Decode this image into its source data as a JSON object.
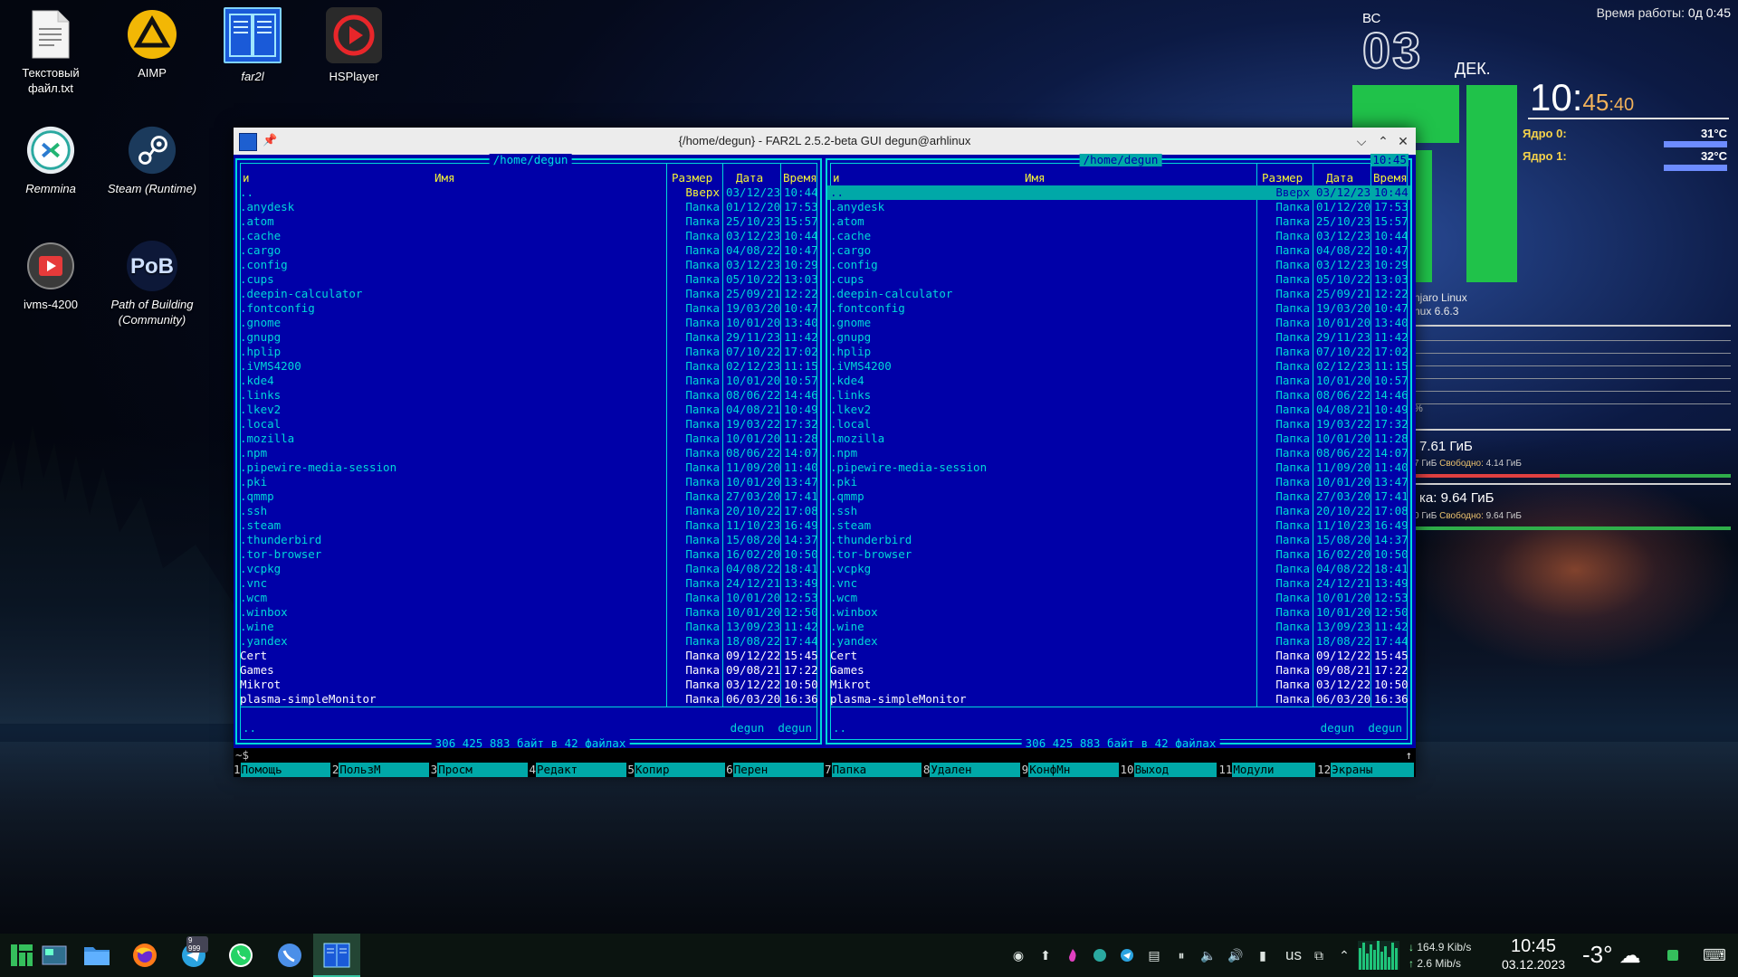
{
  "desktop": {
    "icons": [
      {
        "label": "Текстовый файл.txt",
        "icon": "text-file-icon",
        "italic": false
      },
      {
        "label": "AIMP",
        "icon": "aimp-icon",
        "italic": false
      },
      {
        "label": "far2l",
        "icon": "far2l-icon",
        "italic": true
      },
      {
        "label": "HSPlayer",
        "icon": "hsplayer-icon",
        "italic": false
      },
      {
        "label": "Remmina",
        "icon": "remmina-icon",
        "italic": true
      },
      {
        "label": "Steam (Runtime)",
        "icon": "steam-icon",
        "italic": true
      },
      {
        "label": "ivms-4200",
        "icon": "ivms-icon",
        "italic": false
      },
      {
        "label": "Path of Building (Community)",
        "icon": "pob-icon",
        "italic": true
      },
      {
        "label": "PoB",
        "icon": "pob-text",
        "italic": false
      }
    ]
  },
  "widgets": {
    "uptime_label": "Время работы:",
    "uptime_value": "0д 0:45",
    "date_dow": "ВС",
    "date_day": "03",
    "date_month": "ДЕК.",
    "clock_hm": "10:",
    "clock_m": "45",
    "clock_s": ":40",
    "cores": [
      {
        "label": "Ядро 0:",
        "temp": "31°C"
      },
      {
        "label": "Ядро 1:",
        "temp": "32°C"
      }
    ],
    "sysinfo_line1": "njaro Linux",
    "sysinfo_line2": "nux 6.6.3",
    "percent_fragment": "%",
    "mem1_big": "7.61 ГиБ",
    "mem1_small_prefix": "7 ГиБ",
    "mem1_free_label": "Свободно:",
    "mem1_free_value": "4.14 ГиБ",
    "mem2_big": "ка: 9.64 ГиБ",
    "mem2_small_prefix": "0 ГиБ",
    "mem2_free_label": "Свободно:",
    "mem2_free_value": "9.64 ГиБ"
  },
  "far": {
    "window_title": "{/home/degun} - FAR2L 2.5.2-beta GUI degun@arhlinux",
    "left_path": " /home/degun ",
    "right_path": " /home/degun ",
    "clock": "10:45",
    "col_n": "и",
    "col_name": "Имя",
    "col_size": "Размер",
    "col_date": "Дата",
    "col_time": "Время",
    "up_label": "Вверх",
    "up_name": "..",
    "up_date": "03/12/23",
    "up_time": "10:44",
    "rows": [
      {
        "name": ".anydesk",
        "size": "Папка",
        "date": "01/12/20",
        "time": "17:53",
        "bright": false
      },
      {
        "name": ".atom",
        "size": "Папка",
        "date": "25/10/23",
        "time": "15:57",
        "bright": false
      },
      {
        "name": ".cache",
        "size": "Папка",
        "date": "03/12/23",
        "time": "10:44",
        "bright": false
      },
      {
        "name": ".cargo",
        "size": "Папка",
        "date": "04/08/22",
        "time": "10:47",
        "bright": false
      },
      {
        "name": ".config",
        "size": "Папка",
        "date": "03/12/23",
        "time": "10:29",
        "bright": false
      },
      {
        "name": ".cups",
        "size": "Папка",
        "date": "05/10/22",
        "time": "13:03",
        "bright": false
      },
      {
        "name": ".deepin-calculator",
        "size": "Папка",
        "date": "25/09/21",
        "time": "12:22",
        "bright": false
      },
      {
        "name": ".fontconfig",
        "size": "Папка",
        "date": "19/03/20",
        "time": "10:47",
        "bright": false
      },
      {
        "name": ".gnome",
        "size": "Папка",
        "date": "10/01/20",
        "time": "13:40",
        "bright": false
      },
      {
        "name": ".gnupg",
        "size": "Папка",
        "date": "29/11/23",
        "time": "11:42",
        "bright": false
      },
      {
        "name": ".hplip",
        "size": "Папка",
        "date": "07/10/22",
        "time": "17:02",
        "bright": false
      },
      {
        "name": ".iVMS4200",
        "size": "Папка",
        "date": "02/12/23",
        "time": "11:15",
        "bright": false
      },
      {
        "name": ".kde4",
        "size": "Папка",
        "date": "10/01/20",
        "time": "10:57",
        "bright": false
      },
      {
        "name": ".links",
        "size": "Папка",
        "date": "08/06/22",
        "time": "14:46",
        "bright": false
      },
      {
        "name": ".lkev2",
        "size": "Папка",
        "date": "04/08/21",
        "time": "10:49",
        "bright": false
      },
      {
        "name": ".local",
        "size": "Папка",
        "date": "19/03/22",
        "time": "17:32",
        "bright": false
      },
      {
        "name": ".mozilla",
        "size": "Папка",
        "date": "10/01/20",
        "time": "11:28",
        "bright": false
      },
      {
        "name": ".npm",
        "size": "Папка",
        "date": "08/06/22",
        "time": "14:07",
        "bright": false
      },
      {
        "name": ".pipewire-media-session",
        "size": "Папка",
        "date": "11/09/20",
        "time": "11:40",
        "bright": false
      },
      {
        "name": ".pki",
        "size": "Папка",
        "date": "10/01/20",
        "time": "13:47",
        "bright": false
      },
      {
        "name": ".qmmp",
        "size": "Папка",
        "date": "27/03/20",
        "time": "17:41",
        "bright": false
      },
      {
        "name": ".ssh",
        "size": "Папка",
        "date": "20/10/22",
        "time": "17:08",
        "bright": false
      },
      {
        "name": ".steam",
        "size": "Папка",
        "date": "11/10/23",
        "time": "16:49",
        "bright": false
      },
      {
        "name": ".thunderbird",
        "size": "Папка",
        "date": "15/08/20",
        "time": "14:37",
        "bright": false
      },
      {
        "name": ".tor-browser",
        "size": "Папка",
        "date": "16/02/20",
        "time": "10:50",
        "bright": false
      },
      {
        "name": ".vcpkg",
        "size": "Папка",
        "date": "04/08/22",
        "time": "18:41",
        "bright": false
      },
      {
        "name": ".vnc",
        "size": "Папка",
        "date": "24/12/21",
        "time": "13:49",
        "bright": false
      },
      {
        "name": ".wcm",
        "size": "Папка",
        "date": "10/01/20",
        "time": "12:53",
        "bright": false
      },
      {
        "name": ".winbox",
        "size": "Папка",
        "date": "10/01/20",
        "time": "12:50",
        "bright": false
      },
      {
        "name": ".wine",
        "size": "Папка",
        "date": "13/09/23",
        "time": "11:42",
        "bright": false
      },
      {
        "name": ".yandex",
        "size": "Папка",
        "date": "18/08/22",
        "time": "17:44",
        "bright": false
      },
      {
        "name": "Cert",
        "size": "Папка",
        "date": "09/12/22",
        "time": "15:45",
        "bright": true
      },
      {
        "name": "Games",
        "size": "Папка",
        "date": "09/08/21",
        "time": "17:22",
        "bright": true
      },
      {
        "name": "Mikrot",
        "size": "Папка",
        "date": "03/12/22",
        "time": "10:50",
        "bright": true
      },
      {
        "name": "plasma-simpleMonitor",
        "size": "Папка",
        "date": "06/03/20",
        "time": "16:36",
        "bright": true
      }
    ],
    "footer_left": "..",
    "footer_user1": "degun",
    "footer_user2": "degun",
    "status": " 306 425 883 байт в 42 файлах ",
    "cmd_prompt": "~$",
    "cmd_arrow": "↑",
    "fkeys": [
      {
        "n": "1",
        "t": "Помощь"
      },
      {
        "n": "2",
        "t": "ПользМ"
      },
      {
        "n": "3",
        "t": "Просм"
      },
      {
        "n": "4",
        "t": "Редакт"
      },
      {
        "n": "5",
        "t": "Копир"
      },
      {
        "n": "6",
        "t": "Перен"
      },
      {
        "n": "7",
        "t": "Папка"
      },
      {
        "n": "8",
        "t": "Удален"
      },
      {
        "n": "9",
        "t": "КонфМн"
      },
      {
        "n": "10",
        "t": "Выход"
      },
      {
        "n": "11",
        "t": "Модули"
      },
      {
        "n": "12",
        "t": "Экраны"
      }
    ]
  },
  "taskbar": {
    "telegram_badge": "9 999",
    "keyboard_layout": "us",
    "net_down": "164.9 Kib/s",
    "net_up": "2.6 Mib/s",
    "time": "10:45",
    "date": "03.12.2023",
    "weather_temp": "-3°"
  },
  "colors": {
    "far_bg": "#0000a8",
    "far_cyan": "#00d8d8",
    "far_yellow": "#f4f438",
    "widget_green": "#20c24a",
    "clock_accent": "#f2b25a"
  }
}
